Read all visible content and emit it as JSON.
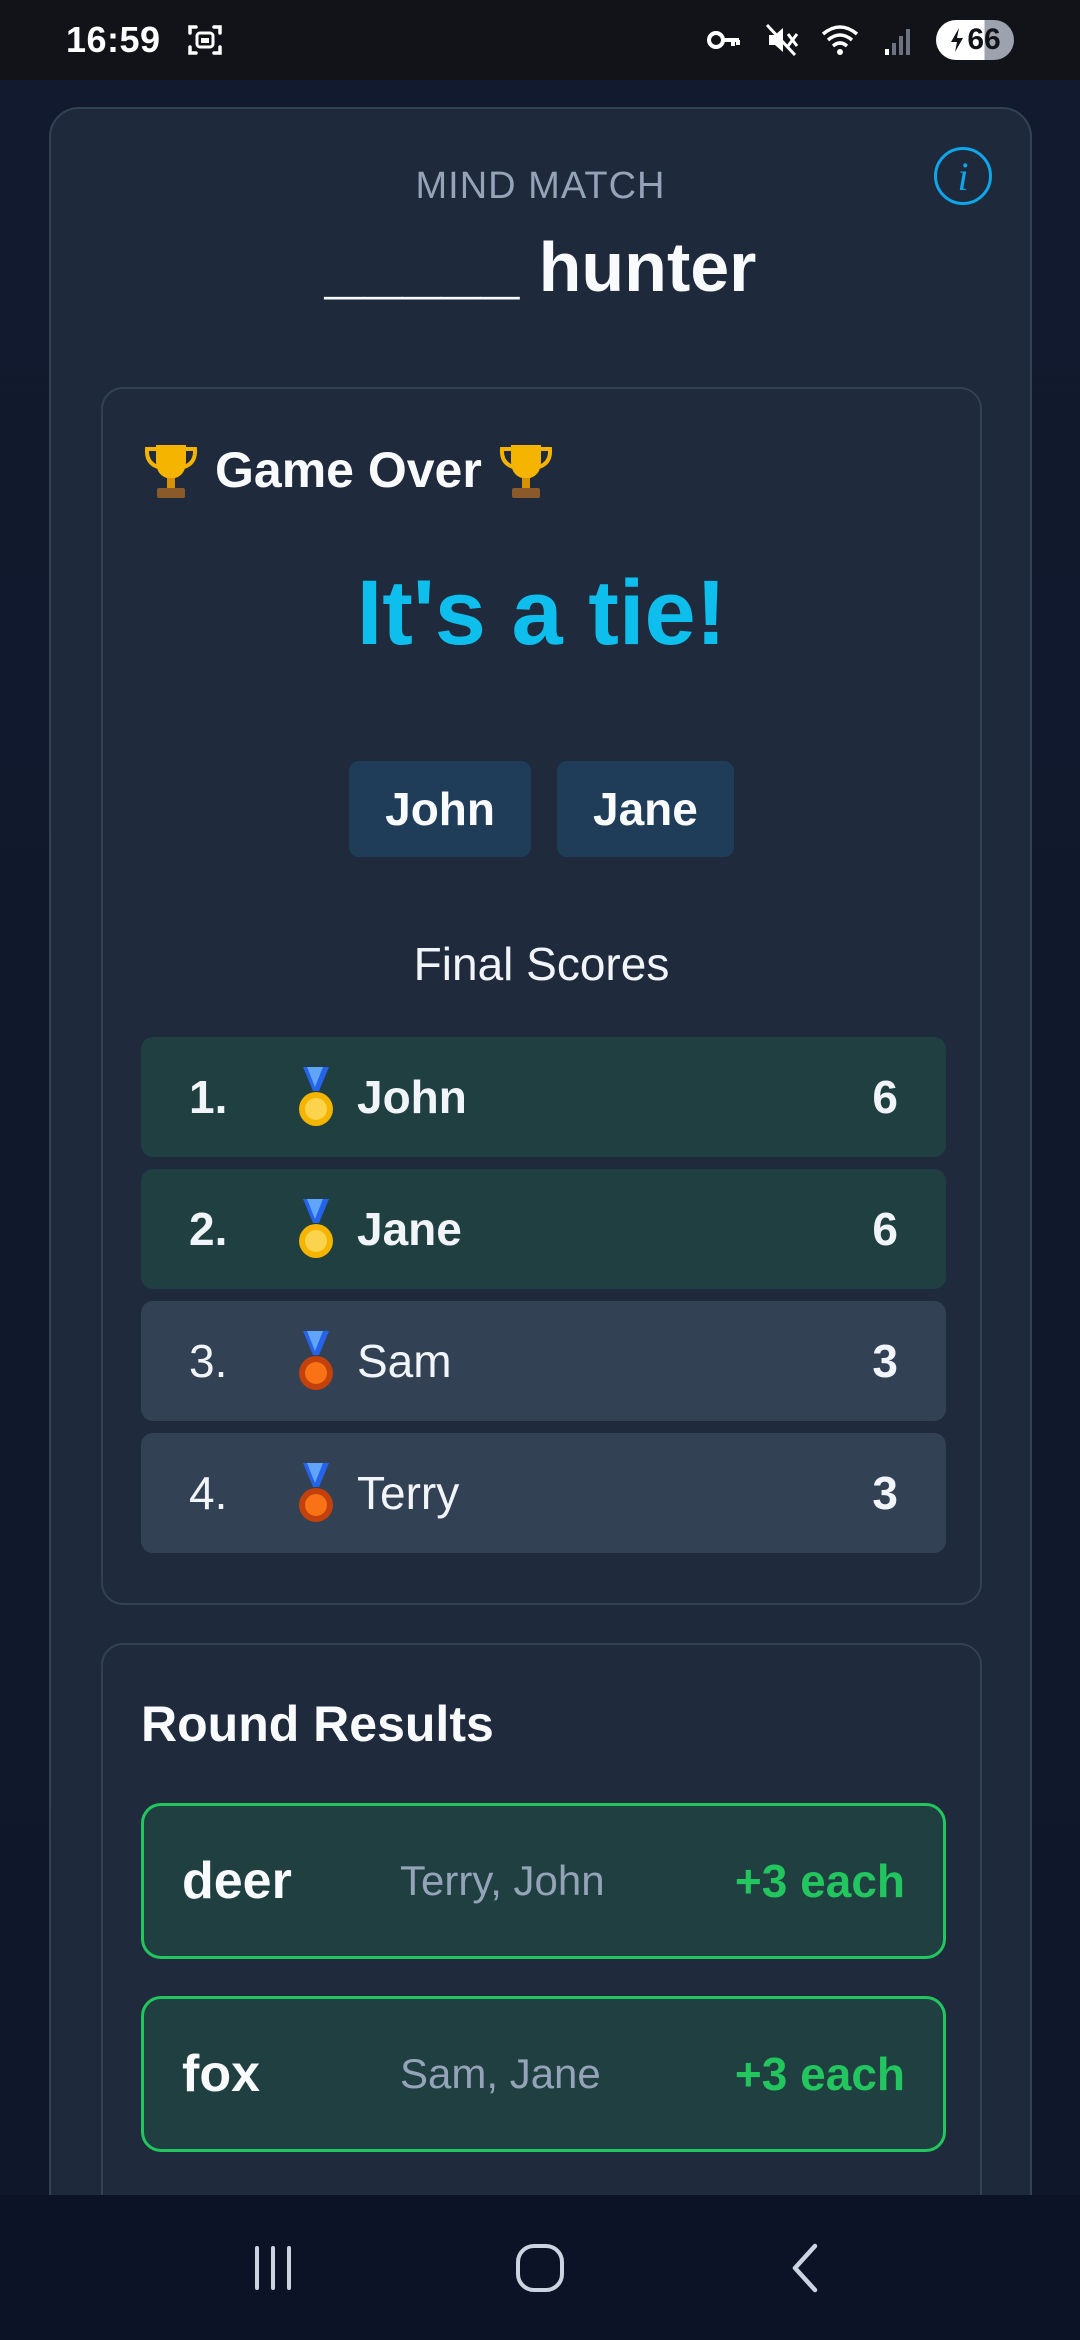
{
  "status_bar": {
    "time": "16:59",
    "battery": "66",
    "icons": [
      "screenshot-icon",
      "vpn-key-icon",
      "mute-icon",
      "wifi-icon",
      "signal-icon",
      "battery-charging-icon"
    ]
  },
  "header": {
    "app_name": "MIND MATCH",
    "prompt": "_____ hunter",
    "info_label": "i"
  },
  "game_over": {
    "heading": "Game Over",
    "result_text": "It's a tie!",
    "winners": [
      "John",
      "Jane"
    ],
    "final_scores_label": "Final Scores",
    "scores": [
      {
        "rank": "1.",
        "medal": "gold",
        "name": "John",
        "score": "6"
      },
      {
        "rank": "2.",
        "medal": "gold",
        "name": "Jane",
        "score": "6"
      },
      {
        "rank": "3.",
        "medal": "bronze",
        "name": "Sam",
        "score": "3"
      },
      {
        "rank": "4.",
        "medal": "bronze",
        "name": "Terry",
        "score": "3"
      }
    ]
  },
  "round_results": {
    "title": "Round Results",
    "items": [
      {
        "word": "deer",
        "players": "Terry, John",
        "points": "+3 each"
      },
      {
        "word": "fox",
        "players": "Sam, Jane",
        "points": "+3 each"
      }
    ]
  },
  "colors": {
    "accent": "#0ebfee",
    "success": "#22c55e",
    "card": "#1e293b",
    "background": "#0f172a"
  }
}
